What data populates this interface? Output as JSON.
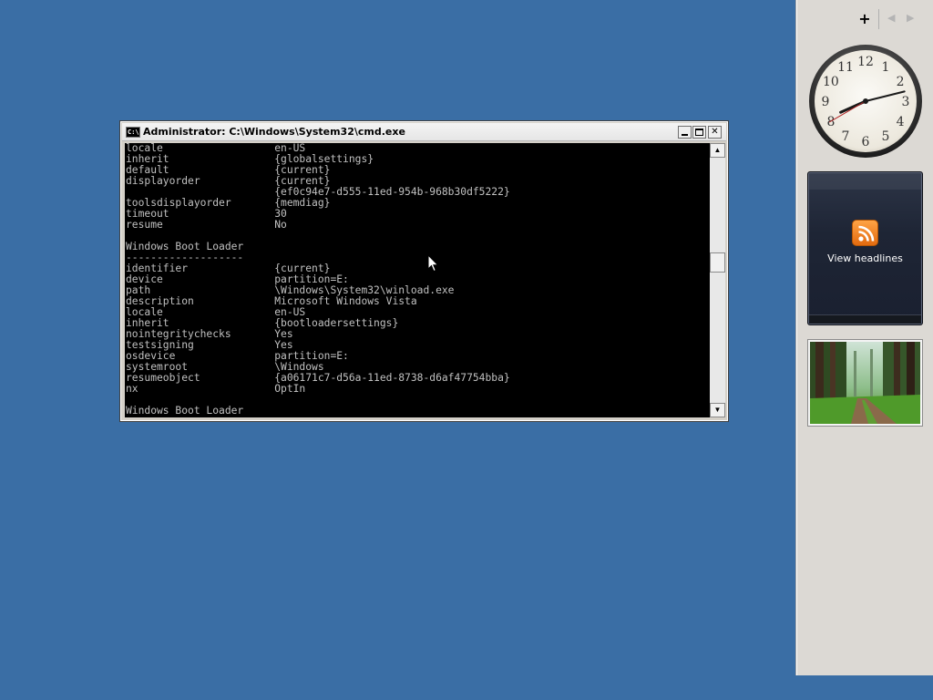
{
  "window": {
    "title": "Administrator: C:\\Windows\\System32\\cmd.exe",
    "icon_text": "C:\\",
    "console_text": "locale                  en-US\ninherit                 {globalsettings}\ndefault                 {current}\ndisplayorder            {current}\n                        {ef0c94e7-d555-11ed-954b-968b30df5222}\ntoolsdisplayorder       {memdiag}\ntimeout                 30\nresume                  No\n\nWindows Boot Loader\n-------------------\nidentifier              {current}\ndevice                  partition=E:\npath                    \\Windows\\System32\\winload.exe\ndescription             Microsoft Windows Vista\nlocale                  en-US\ninherit                 {bootloadersettings}\nnointegritychecks       Yes\ntestsigning             Yes\nosdevice                partition=E:\nsystemroot              \\Windows\nresumeobject            {a06171c7-d56a-11ed-8738-d6af47754bba}\nnx                      OptIn\n\nWindows Boot Loader",
    "scroll_position": 0.42
  },
  "sidebar": {
    "add_label": "+",
    "prev_label": "◀",
    "next_label": "▶",
    "feed_label": "View headlines",
    "clock_time": "8:12:40",
    "clock_numerals": [
      "12",
      "1",
      "2",
      "3",
      "4",
      "5",
      "6",
      "7",
      "8",
      "9",
      "10",
      "11"
    ]
  },
  "colors": {
    "desktop": "#3a6ea5",
    "console_bg": "#000000",
    "console_fg": "#c0c0c0",
    "rss_orange": "#f7941d"
  },
  "icons": [
    "cmd-icon",
    "minimize-icon",
    "maximize-icon",
    "close-icon",
    "rss-icon",
    "plus-icon",
    "arrow-left-icon",
    "arrow-right-icon"
  ]
}
